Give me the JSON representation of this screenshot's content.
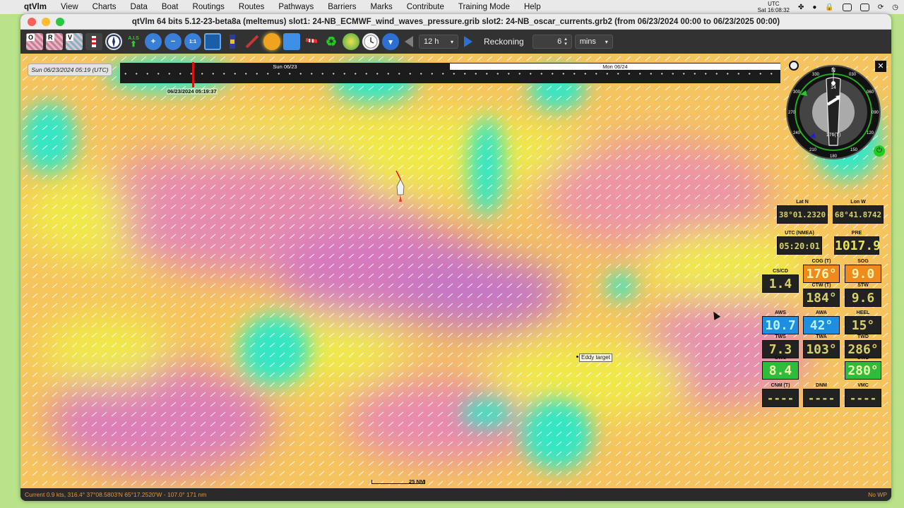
{
  "menubar": {
    "app": "qtVlm",
    "items": [
      "View",
      "Charts",
      "Data",
      "Boat",
      "Routings",
      "Routes",
      "Pathways",
      "Barriers",
      "Marks",
      "Contribute",
      "Training Mode",
      "Help"
    ],
    "clock_tz": "UTC",
    "clock_time": "Sat 16:08:32"
  },
  "window": {
    "title": "qtVlm 64 bits 5.12-23-beta8a (meltemus) slot1: 24-NB_ECMWF_wind_waves_pressure.grib slot2: 24-NB_oscar_currents.grb2 (from 06/23/2024 00:00 to 06/23/2025 00:00)"
  },
  "toolbar": {
    "chart_o": "O",
    "chart_r": "R",
    "chart_v": "V",
    "ais": "A.I.S",
    "zoom_fit": "1:1",
    "step_value": "12 h",
    "mode_label": "Reckoning",
    "reckon_value": "6",
    "reckon_unit": "mins"
  },
  "timeline": {
    "current_date": "Sun 06/23/2024 05:19 (UTC)",
    "day1": "Sun 06/23",
    "day2": "Mon 06/24",
    "marker_label": "06/23/2024 05:19:37"
  },
  "compass": {
    "heading_label": "176(T)",
    "top_label": "N",
    "ticks": [
      "330",
      "030",
      "060",
      "090",
      "120",
      "150",
      "180",
      "210",
      "240",
      "270",
      "300"
    ],
    "value_label": "14"
  },
  "instruments": {
    "lat": {
      "label": "Lat N",
      "value": "38°01.2320"
    },
    "lon": {
      "label": "Lon W",
      "value": "68°41.8742"
    },
    "utc": {
      "label": "UTC (NMEA)",
      "value": "05:20:01"
    },
    "pre": {
      "label": "PRE",
      "value": "1017.9"
    },
    "cog": {
      "label": "COG (T)",
      "value": "176°"
    },
    "sog": {
      "label": "SOG",
      "value": "9.0"
    },
    "cscd": {
      "label": "CS/CD",
      "value": "1.4"
    },
    "ctw": {
      "label": "CTW (T)",
      "value": "184°"
    },
    "stw": {
      "label": "STW",
      "value": "9.6"
    },
    "aws": {
      "label": "AWS",
      "value": "10.7"
    },
    "awa": {
      "label": "AWA",
      "value": "42°"
    },
    "heel": {
      "label": "HEEL",
      "value": "15°"
    },
    "tws": {
      "label": "TWS",
      "value": "7.3"
    },
    "twa": {
      "label": "TWA",
      "value": "103°"
    },
    "twd": {
      "label": "TWD",
      "value": "286°"
    },
    "gws": {
      "label": "GWS",
      "value": "8.4"
    },
    "gwd": {
      "label": "GWD",
      "value": "280°"
    },
    "cnm": {
      "label": "CNM (T)",
      "value": "----"
    },
    "dnm": {
      "label": "DNM",
      "value": "----"
    },
    "vmc": {
      "label": "VMC",
      "value": "----"
    }
  },
  "map": {
    "eddy_label": "Eddy target",
    "scale_label": "25 NM"
  },
  "status": {
    "left": "Current 0.9 kts, 316.4° 37°08.5803'N 65°17.2520'W - 107.0° 171 nm",
    "right": "No WP"
  },
  "colors": {
    "field_yellow": "#f5ef4a",
    "field_orange": "#f6b65c",
    "field_pink": "#e37fb0",
    "field_purple": "#c177c4",
    "field_cyan": "#2fe8c0"
  }
}
